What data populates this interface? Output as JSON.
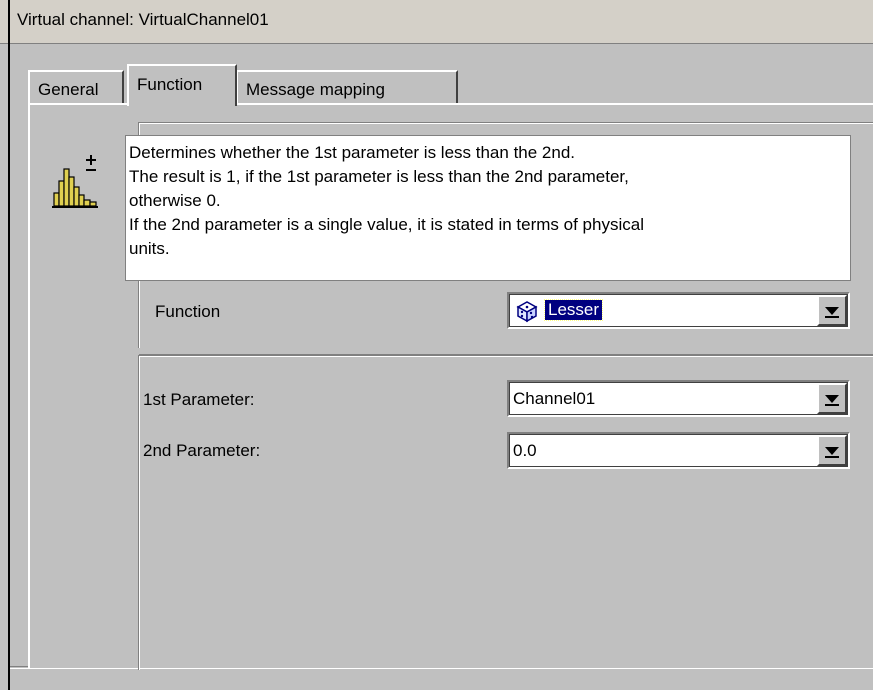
{
  "window": {
    "title": "Virtual channel: VirtualChannel01"
  },
  "tabs": [
    {
      "label": "General"
    },
    {
      "label": "Function"
    },
    {
      "label": "Message mapping"
    }
  ],
  "function_icon": "histogram-plus-minus-icon",
  "description": {
    "lines": [
      "Determines whether the 1st parameter is less than the 2nd.",
      "The result is 1, if the 1st parameter is less than the 2nd parameter,",
      "otherwise 0.",
      "If the 2nd parameter is a single value, it is stated in terms of physical",
      "units."
    ]
  },
  "function_field": {
    "label": "Function",
    "value": "Lesser",
    "icon": "dice-icon"
  },
  "param1": {
    "label": "1st Parameter:",
    "value": "Channel01"
  },
  "param2": {
    "label": "2nd Parameter:",
    "value": "0.0"
  },
  "colors": {
    "face": "#c0c0c0",
    "selection": "#000080",
    "icon": "#e0d050"
  }
}
